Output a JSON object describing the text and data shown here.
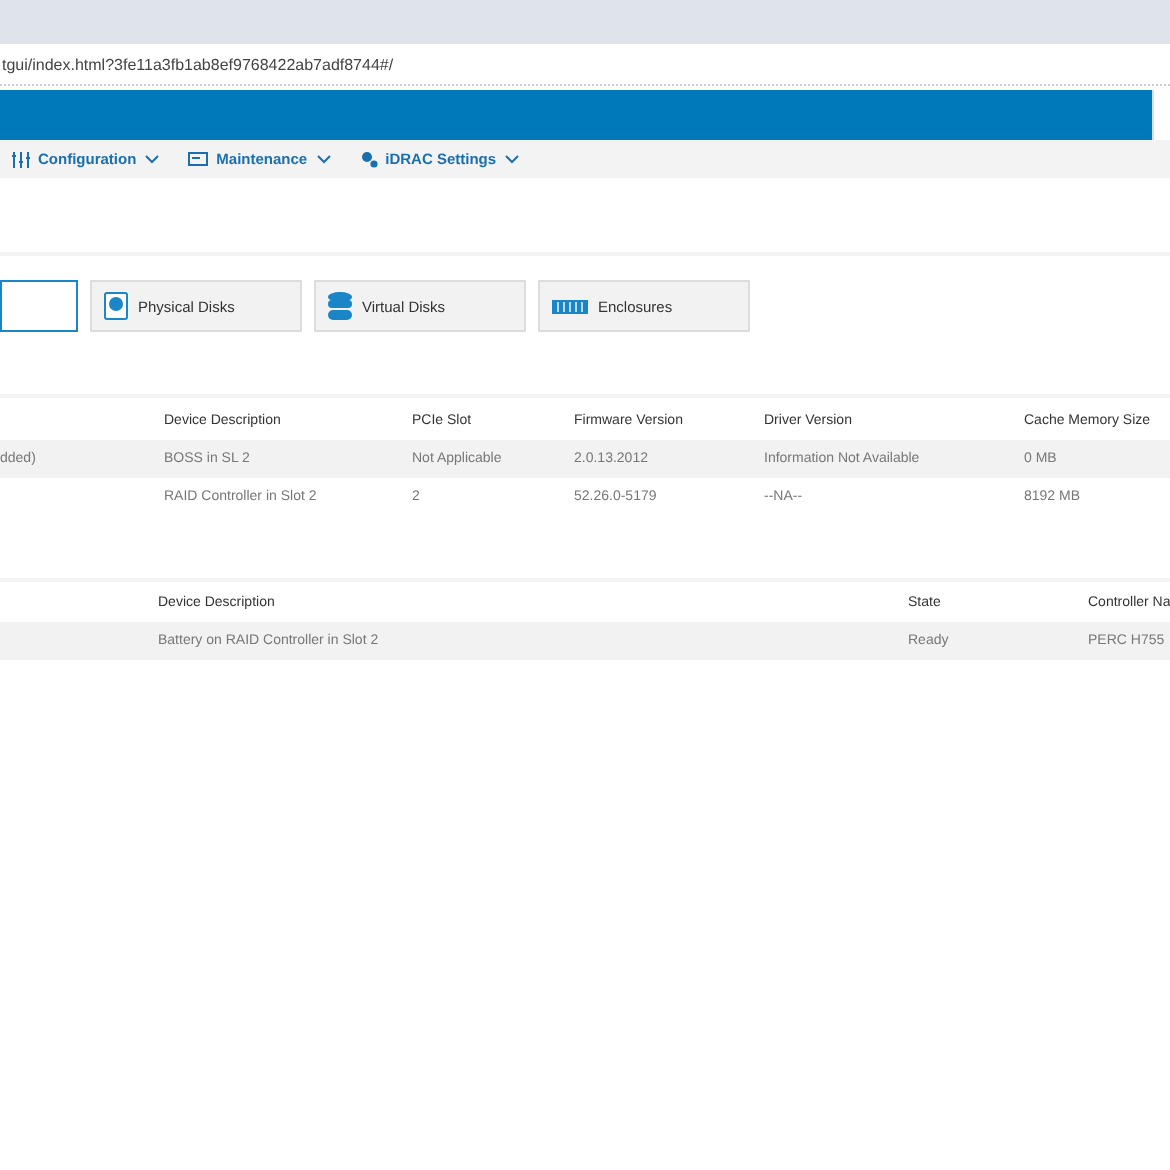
{
  "address_bar": {
    "url": "tgui/index.html?3fe11a3fb1ab8ef9768422ab7adf8744#/"
  },
  "nav": [
    {
      "kind": "config",
      "label": "Configuration"
    },
    {
      "kind": "maintenance",
      "label": "Maintenance"
    },
    {
      "kind": "settings",
      "label": "iDRAC Settings"
    }
  ],
  "tiles": [
    {
      "kind": "blank",
      "selected": true
    },
    {
      "kind": "physical",
      "label": "Physical Disks",
      "selected": false
    },
    {
      "kind": "virtual",
      "label": "Virtual Disks",
      "selected": false
    },
    {
      "kind": "enclosure",
      "label": "Enclosures",
      "selected": false
    }
  ],
  "controllers_table": {
    "columns": [
      "Device Description",
      "PCIe Slot",
      "Firmware Version",
      "Driver Version",
      "Cache Memory Size"
    ],
    "rows": [
      {
        "column_1": "dded)",
        "cells": [
          "BOSS in SL 2",
          "Not Applicable",
          "2.0.13.2012",
          "Information Not Available",
          "0 MB"
        ]
      },
      {
        "cells": [
          "RAID Controller in Slot 2",
          "2",
          "52.26.0-5179",
          "--NA--",
          "8192 MB"
        ]
      }
    ]
  },
  "batteries_table": {
    "columns": [
      "Device Description",
      "State",
      "Controller Na"
    ],
    "rows": [
      {
        "cells": [
          "Battery on RAID Controller in Slot 2",
          "Ready",
          "PERC H755"
        ]
      }
    ]
  }
}
